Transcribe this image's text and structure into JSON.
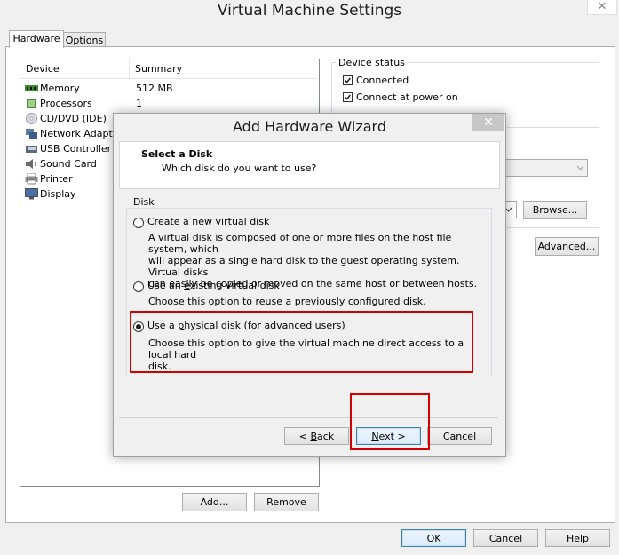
{
  "window": {
    "title": "Virtual Machine Settings",
    "close_glyph": "✕"
  },
  "tabs": [
    {
      "label": "Hardware"
    },
    {
      "label": "Options"
    }
  ],
  "device_list": {
    "col_device": "Device",
    "col_summary": "Summary",
    "rows": [
      {
        "device": "Memory",
        "summary": "512 MB",
        "icon": "memory-icon"
      },
      {
        "device": "Processors",
        "summary": "1",
        "icon": "processor-icon"
      },
      {
        "device": "CD/DVD (IDE)",
        "summary": "",
        "icon": "cd-icon"
      },
      {
        "device": "Network Adapter",
        "summary": "",
        "icon": "network-icon"
      },
      {
        "device": "USB Controller",
        "summary": "",
        "icon": "usb-icon"
      },
      {
        "device": "Sound Card",
        "summary": "",
        "icon": "sound-icon"
      },
      {
        "device": "Printer",
        "summary": "",
        "icon": "printer-icon"
      },
      {
        "device": "Display",
        "summary": "",
        "icon": "display-icon"
      }
    ]
  },
  "device_status": {
    "label": "Device status",
    "connected": {
      "label": "Connected",
      "checked": true
    },
    "connect_at_power_on": {
      "label": "Connect at power on",
      "checked": true
    }
  },
  "right_panel": {
    "browse_label": "Browse...",
    "advanced_label": "Advanced..."
  },
  "list_buttons": {
    "add_label": "Add...",
    "remove_label": "Remove"
  },
  "footer": {
    "ok_label": "OK",
    "cancel_label": "Cancel",
    "help_label": "Help"
  },
  "wizard": {
    "title": "Add Hardware Wizard",
    "close_glyph": "✕",
    "heading": "Select a Disk",
    "subheading": "Which disk do you want to use?",
    "group_label": "Disk",
    "options": [
      {
        "label_pre": "Create a new ",
        "label_u": "v",
        "label_post": "irtual disk",
        "desc_lines": [
          "A virtual disk is composed of one or more files on the host file system, which",
          "will appear as a single hard disk to the guest operating system. Virtual disks",
          "can easily be copied or moved on the same host or between hosts."
        ],
        "selected": false
      },
      {
        "label_pre": "Use an ",
        "label_u": "e",
        "label_post": "xisting virtual disk",
        "desc_lines": [
          "Choose this option to reuse a previously configured disk."
        ],
        "selected": false
      },
      {
        "label_pre": "Use a ",
        "label_u": "p",
        "label_post": "hysical disk (for advanced users)",
        "desc_lines": [
          "Choose this option to give the virtual machine direct access to a local hard",
          "disk."
        ],
        "selected": true
      }
    ],
    "buttons": {
      "back": {
        "pre": "< ",
        "u": "B",
        "post": "ack"
      },
      "next": {
        "pre": "",
        "u": "N",
        "post": "ext >"
      },
      "cancel_label": "Cancel"
    }
  },
  "colors": {
    "highlight": "#d40000"
  }
}
